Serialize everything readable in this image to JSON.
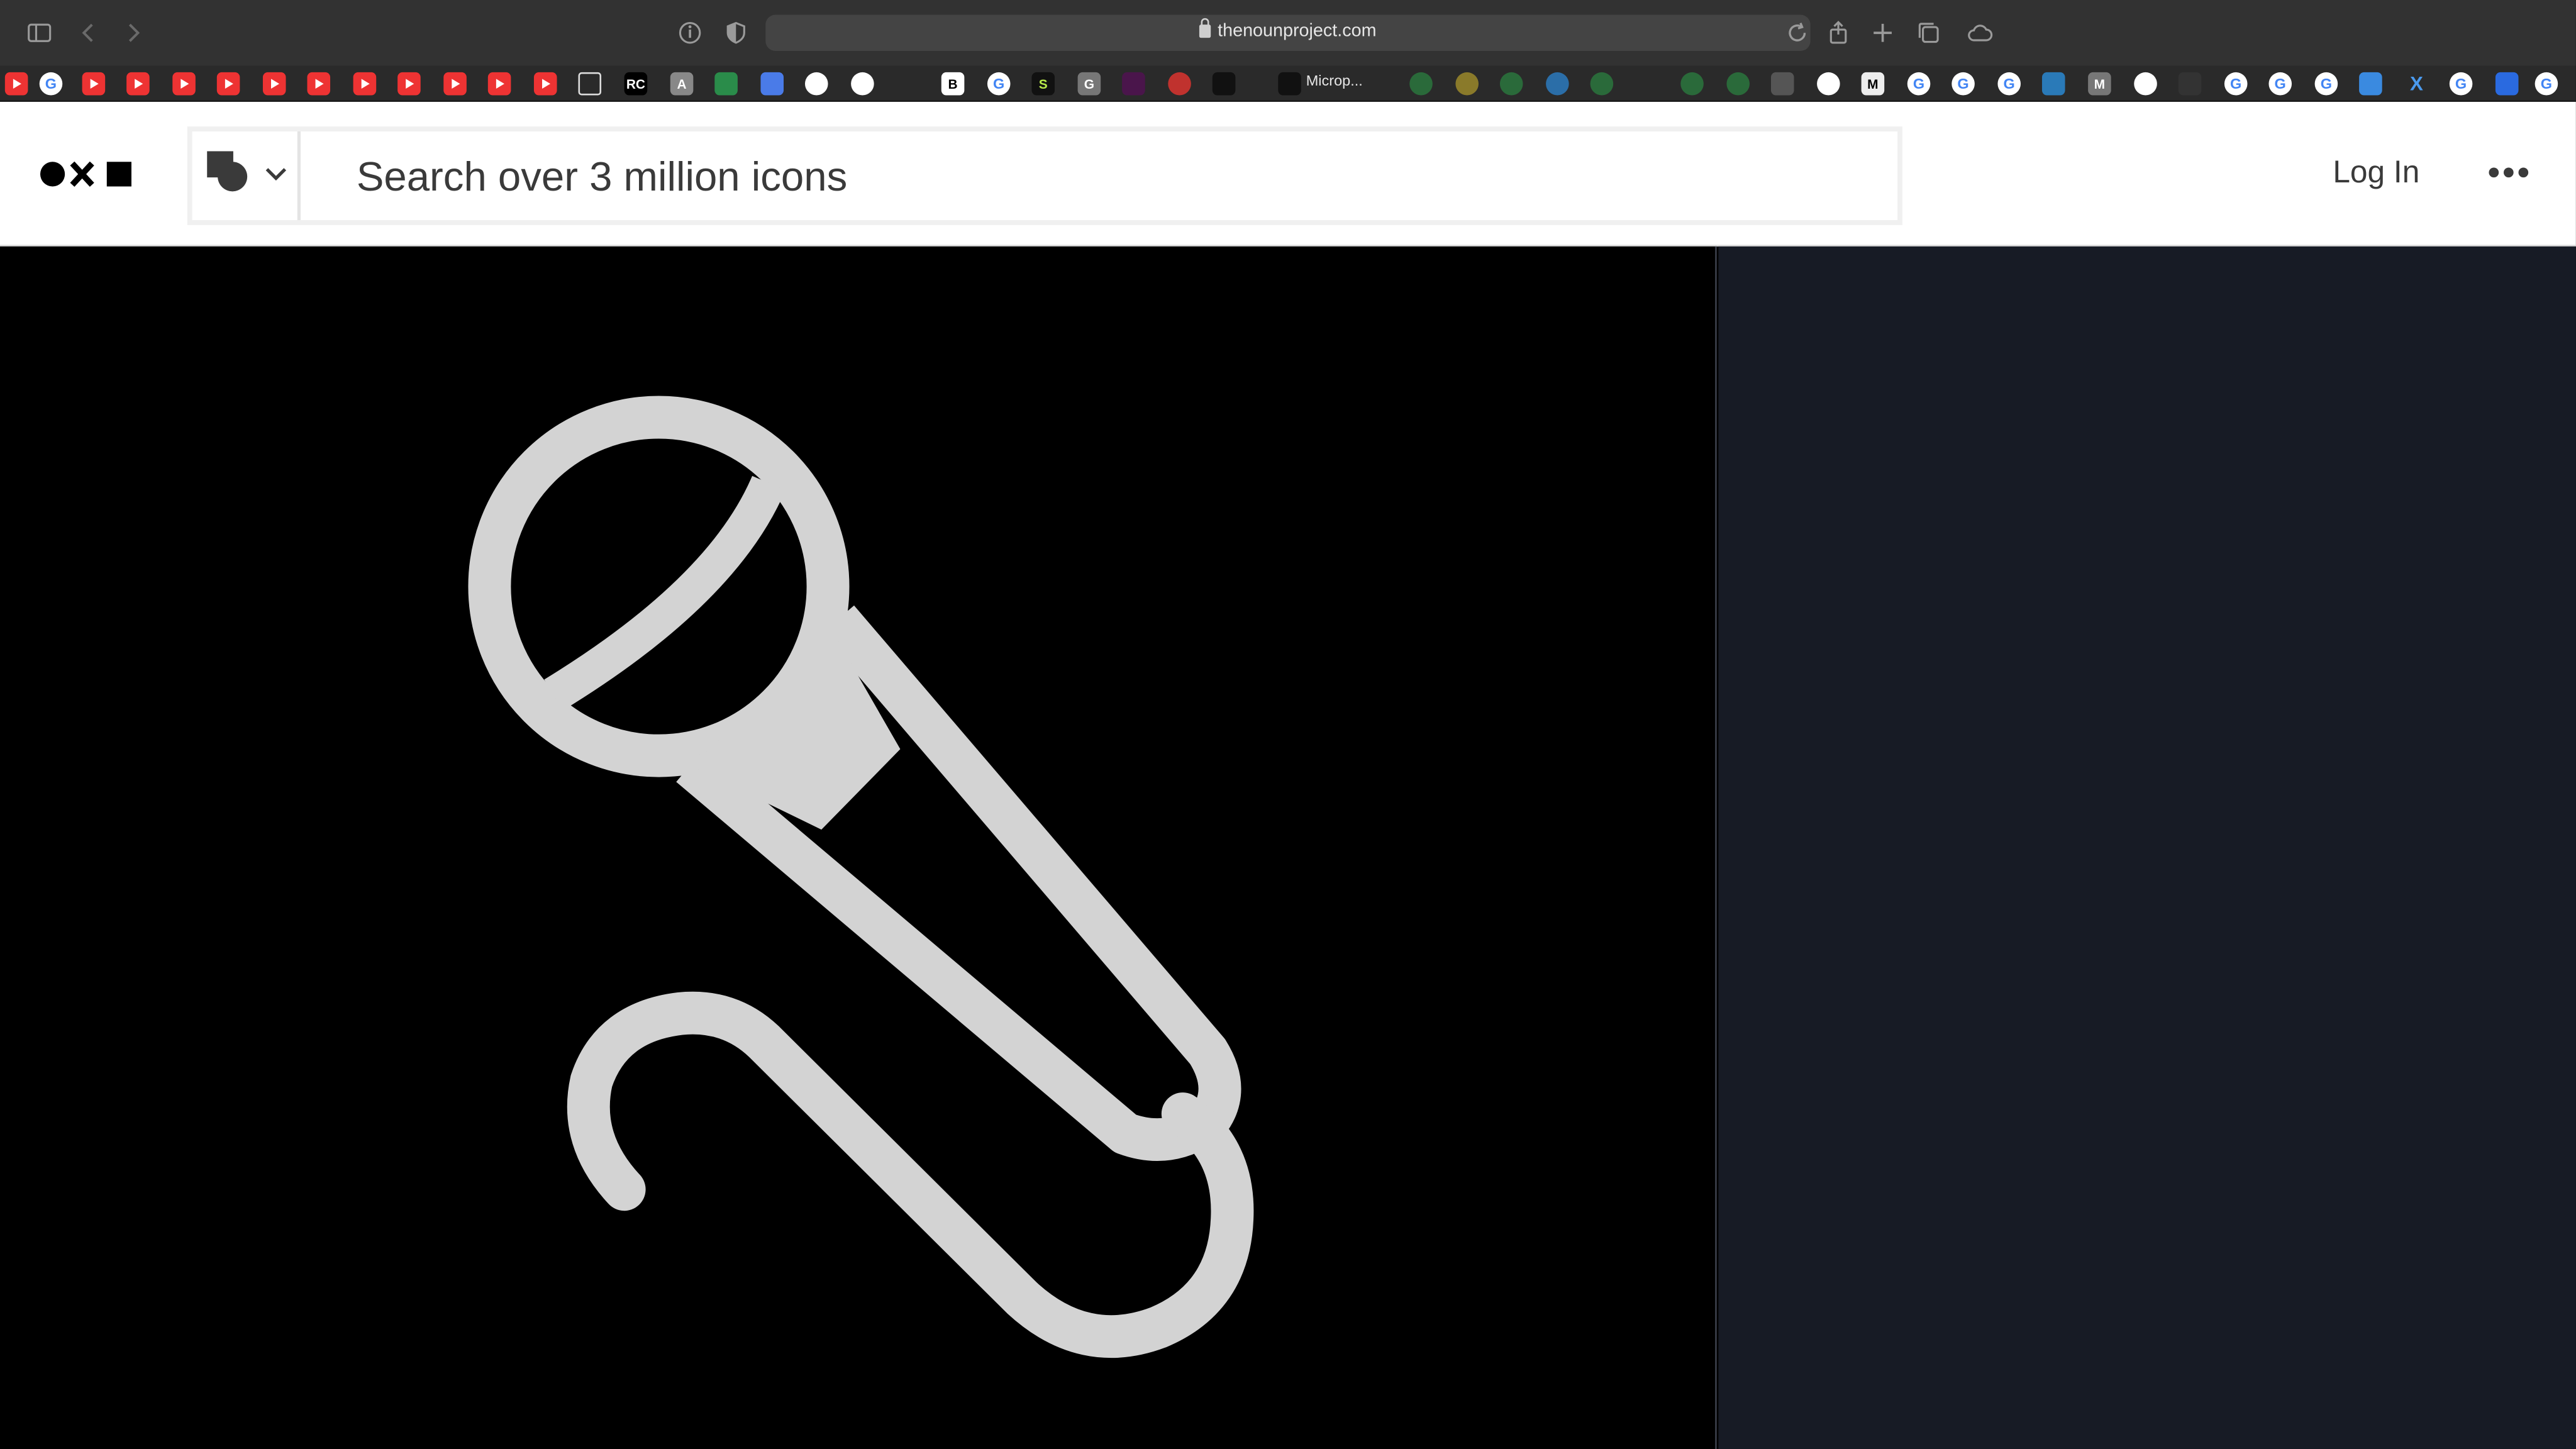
{
  "browser": {
    "url": "thenounproject.com",
    "tab_label": "Microp...",
    "icons": [
      "sidebar-toggle-icon",
      "back-icon",
      "forward-icon",
      "privacy-report-icon",
      "shield-icon",
      "lock-icon",
      "reload-icon",
      "share-icon",
      "new-tab-icon",
      "tab-overview-icon",
      "icloud-icon"
    ],
    "favorites_text": {
      "rc": "RC",
      "a": "A",
      "b": "B",
      "s": "S",
      "g": "G",
      "m": "M",
      "x": "X"
    }
  },
  "header": {
    "search_placeholder": "Search over 3 million icons",
    "login_label": "Log In"
  },
  "viewer": {
    "icon": "microphone-icon",
    "icon_color": "#d3d3d3",
    "background": "#000000"
  },
  "sidepanel": {
    "background": "#171b25"
  }
}
